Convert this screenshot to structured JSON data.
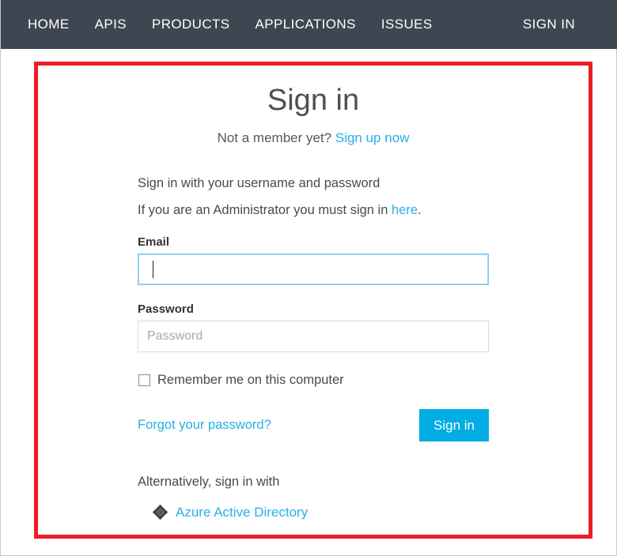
{
  "nav": {
    "items": [
      {
        "label": "HOME",
        "name": "nav-item-home"
      },
      {
        "label": "APIS",
        "name": "nav-item-apis"
      },
      {
        "label": "PRODUCTS",
        "name": "nav-item-products"
      },
      {
        "label": "APPLICATIONS",
        "name": "nav-item-applications"
      },
      {
        "label": "ISSUES",
        "name": "nav-item-issues"
      }
    ],
    "sign_in": "SIGN IN",
    "background_color": "#3e4651",
    "text_color": "#ffffff"
  },
  "highlight": {
    "color": "#ed1c24",
    "name": "red-annotation-rectangle"
  },
  "signin": {
    "title": "Sign in",
    "member_prompt": "Not a member yet?",
    "signup_link": "Sign up now",
    "intro_line_1": "Sign in with your username and password",
    "intro_line_2_prefix": "If you are an Administrator you must sign in ",
    "intro_line_2_link": "here",
    "intro_line_2_suffix": ".",
    "email": {
      "label": "Email",
      "value": "",
      "placeholder": "",
      "focused": true
    },
    "password": {
      "label": "Password",
      "value": "",
      "placeholder": "Password",
      "focused": false
    },
    "remember_label": "Remember me on this computer",
    "remember_checked": false,
    "forgot_link": "Forgot your password?",
    "submit_label": "Sign in",
    "alternative_heading": "Alternatively, sign in with",
    "providers": [
      {
        "label": "Azure Active Directory",
        "icon": "azure-active-directory-icon"
      }
    ],
    "link_color": "#27b0e6",
    "button_color": "#00ade4"
  }
}
